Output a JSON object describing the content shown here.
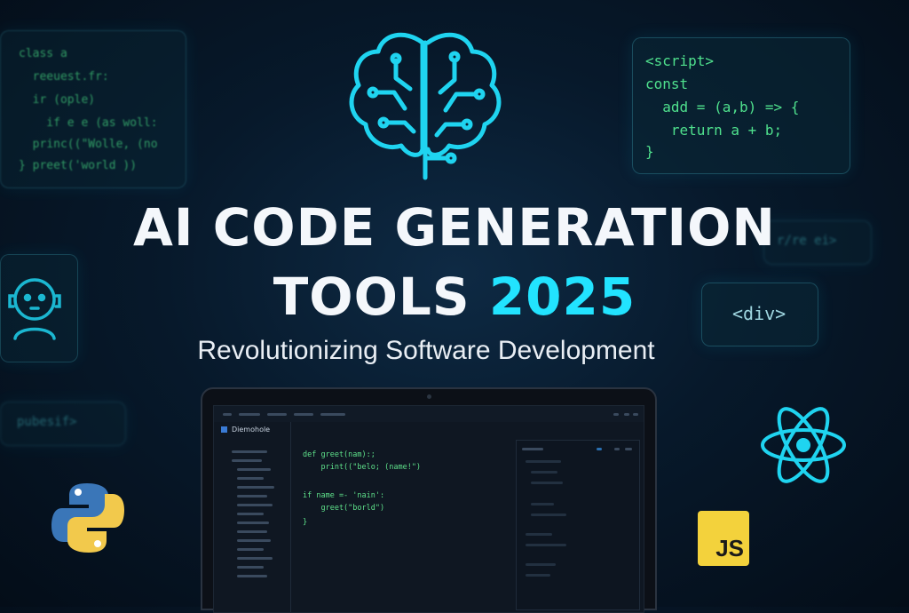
{
  "hero": {
    "title_line1": "AI CODE GENERATION",
    "title_line2_prefix": "TOOLS ",
    "title_year": "2025",
    "subtitle": "Revolutionizing Software Development"
  },
  "code_panel_left": {
    "lines": [
      "class a",
      "  reeuest.fr:",
      "  ir (ople)",
      "    if e e (as woll:",
      "  princ((\"Wolle, (no",
      "} preet('world ))"
    ]
  },
  "code_panel_right": {
    "lines": [
      "<script>",
      "const",
      "  add = (a,b) => {",
      "   return a + b;",
      "}"
    ]
  },
  "floating_tags": {
    "div_tag": "<div>",
    "faint_right": "r/re ei>",
    "faint_left": "pubesif>"
  },
  "laptop": {
    "project_name": "Diemohole",
    "code_lines": [
      "def greet(nam):;",
      "    print((\"belo; (name!\")",
      "",
      "if name =- 'nain':",
      "    greet(\"borld\")",
      "}"
    ]
  },
  "icons": {
    "brain": "brain-circuit-icon",
    "robot": "robot-face-icon",
    "python": "python-logo-icon",
    "react": "react-atom-icon",
    "javascript": "javascript-logo-icon",
    "js_label": "JS"
  },
  "colors": {
    "accent_cyan": "#22e3ff",
    "code_green": "#4fe08d",
    "js_yellow": "#f3d23c",
    "python_blue": "#3a76b8",
    "python_yellow": "#f2c94c"
  }
}
